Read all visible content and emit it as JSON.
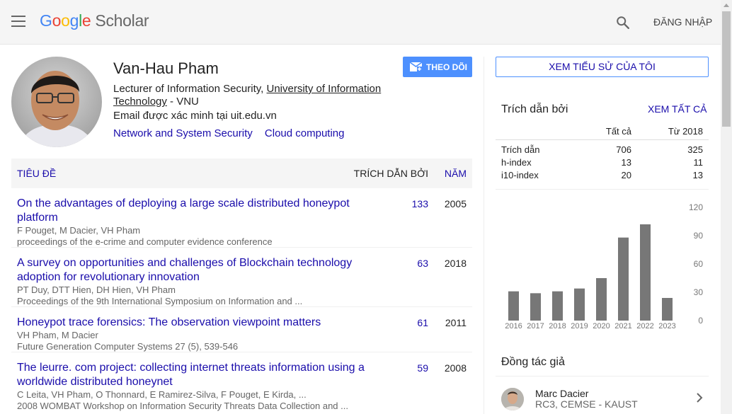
{
  "header": {
    "logo_letters": [
      "G",
      "o",
      "o",
      "g",
      "l",
      "e"
    ],
    "logo_product": "Scholar",
    "signin_label": "ĐĂNG NHẬP"
  },
  "profile": {
    "name": "Van-Hau Pham",
    "affiliation_prefix": "Lecturer of Information Security, ",
    "affiliation_link": "University of Information Technology",
    "affiliation_suffix": " - VNU",
    "email": "Email được xác minh tại uit.edu.vn",
    "interests": [
      "Network and System Security",
      "Cloud computing"
    ],
    "follow_label": "THEO DÕI"
  },
  "table": {
    "col_title": "TIÊU ĐỀ",
    "col_cited": "TRÍCH DẪN BỞI",
    "col_year": "NĂM",
    "rows": [
      {
        "title": "On the advantages of deploying a large scale distributed honeypot platform",
        "authors": "F Pouget, M Dacier, VH Pham",
        "venue": "proceedings of the e-crime and computer evidence conference",
        "cited": "133",
        "year": "2005"
      },
      {
        "title": "A survey on opportunities and challenges of Blockchain technology adoption for revolutionary innovation",
        "authors": "PT Duy, DTT Hien, DH Hien, VH Pham",
        "venue": "Proceedings of the 9th International Symposium on Information and ...",
        "cited": "63",
        "year": "2018"
      },
      {
        "title": "Honeypot trace forensics: The observation viewpoint matters",
        "authors": "VH Pham, M Dacier",
        "venue": "Future Generation Computer Systems 27 (5), 539-546",
        "cited": "61",
        "year": "2011"
      },
      {
        "title": "The leurre. com project: collecting internet threats information using a worldwide distributed honeynet",
        "authors": "C Leita, VH Pham, O Thonnard, E Ramirez-Silva, F Pouget, E Kirda, ...",
        "venue": "2008 WOMBAT Workshop on Information Security Threats Data Collection and ...",
        "cited": "59",
        "year": "2008"
      }
    ]
  },
  "sidebar": {
    "cv_button": "XEM TIỂU SỬ CỦA TÔI",
    "cited_by_heading": "Trích dẫn bởi",
    "view_all": "XEM TẤT CẢ",
    "stats_header": [
      "Tất cả",
      "Từ 2018"
    ],
    "stats": [
      {
        "label": "Trích dẫn",
        "all": "706",
        "since": "325"
      },
      {
        "label": "h-index",
        "all": "13",
        "since": "11"
      },
      {
        "label": "i10-index",
        "all": "20",
        "since": "13"
      }
    ],
    "coauthors_heading": "Đồng tác giả",
    "coauthor": {
      "name": "Marc Dacier",
      "affiliation": "RC3, CEMSE - KAUST"
    }
  },
  "chart_data": {
    "type": "bar",
    "categories": [
      "2016",
      "2017",
      "2018",
      "2019",
      "2020",
      "2021",
      "2022",
      "2023"
    ],
    "values": [
      31,
      29,
      31,
      34,
      45,
      88,
      102,
      24
    ],
    "ylim": [
      0,
      120
    ],
    "yticks": [
      0,
      30,
      60,
      90,
      120
    ],
    "bar_color": "#777777",
    "grid": false
  },
  "colors": {
    "link": "#1a0dab",
    "button_blue": "#4d90fe"
  }
}
